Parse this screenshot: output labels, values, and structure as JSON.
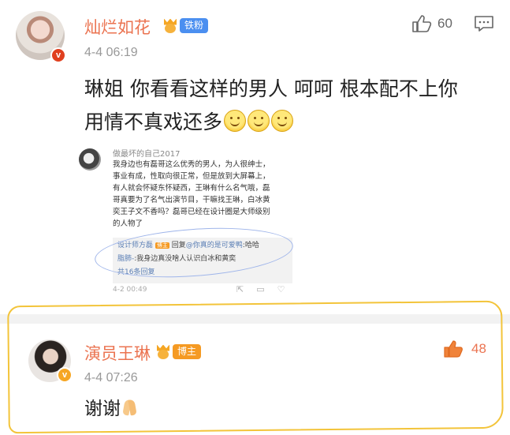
{
  "comment1": {
    "username": "灿烂如花",
    "badge_label": "铁粉",
    "time": "4-4 06:19",
    "text_line1": "琳姐 你看看这样的男人 呵呵 根本配不上你",
    "text_line2": "用情不真戏还多",
    "like_count": "60"
  },
  "embedded_post": {
    "author": "做最坏的自己2017",
    "body_lines": [
      "我身边也有磊哥这么优秀的男人，为人很绅士，",
      "事业有成，性取向很正常，但是放到大屏幕上，",
      "有人就会怀疑东怀疑西，王琳有什么名气哦，磊",
      "哥真要为了名气出演节目，干嘛找王琳，白冰黄",
      "奕王子文不香吗？磊哥已经在设计圈是大师级别",
      "的人物了"
    ],
    "reply1_user": "设计师方磊",
    "reply1_badge": "博主",
    "reply1_mid": "回复",
    "reply1_target": "@你真的是可爱鸭",
    "reply1_text": ":哈哈",
    "reply2_user": "脂肺-",
    "reply2_text": ":我身边真没啥人认识白冰和黄奕",
    "more_replies": "共16条回复",
    "time": "4-2 00:49"
  },
  "comment2": {
    "username": "演员王琳",
    "badge_label": "博主",
    "time": "4-4 07:26",
    "text": "谢谢",
    "like_count": "48"
  },
  "colors": {
    "username": "#eb7350",
    "highlight_border": "#f3c43a",
    "tag_blue": "#4b8ff0",
    "tag_orange": "#f59a23"
  },
  "icons": [
    "thumbs-up-icon",
    "comment-icon",
    "crown-medal-icon",
    "smile-emoji-icon",
    "pray-emoji-icon",
    "verified-badge-icon"
  ]
}
